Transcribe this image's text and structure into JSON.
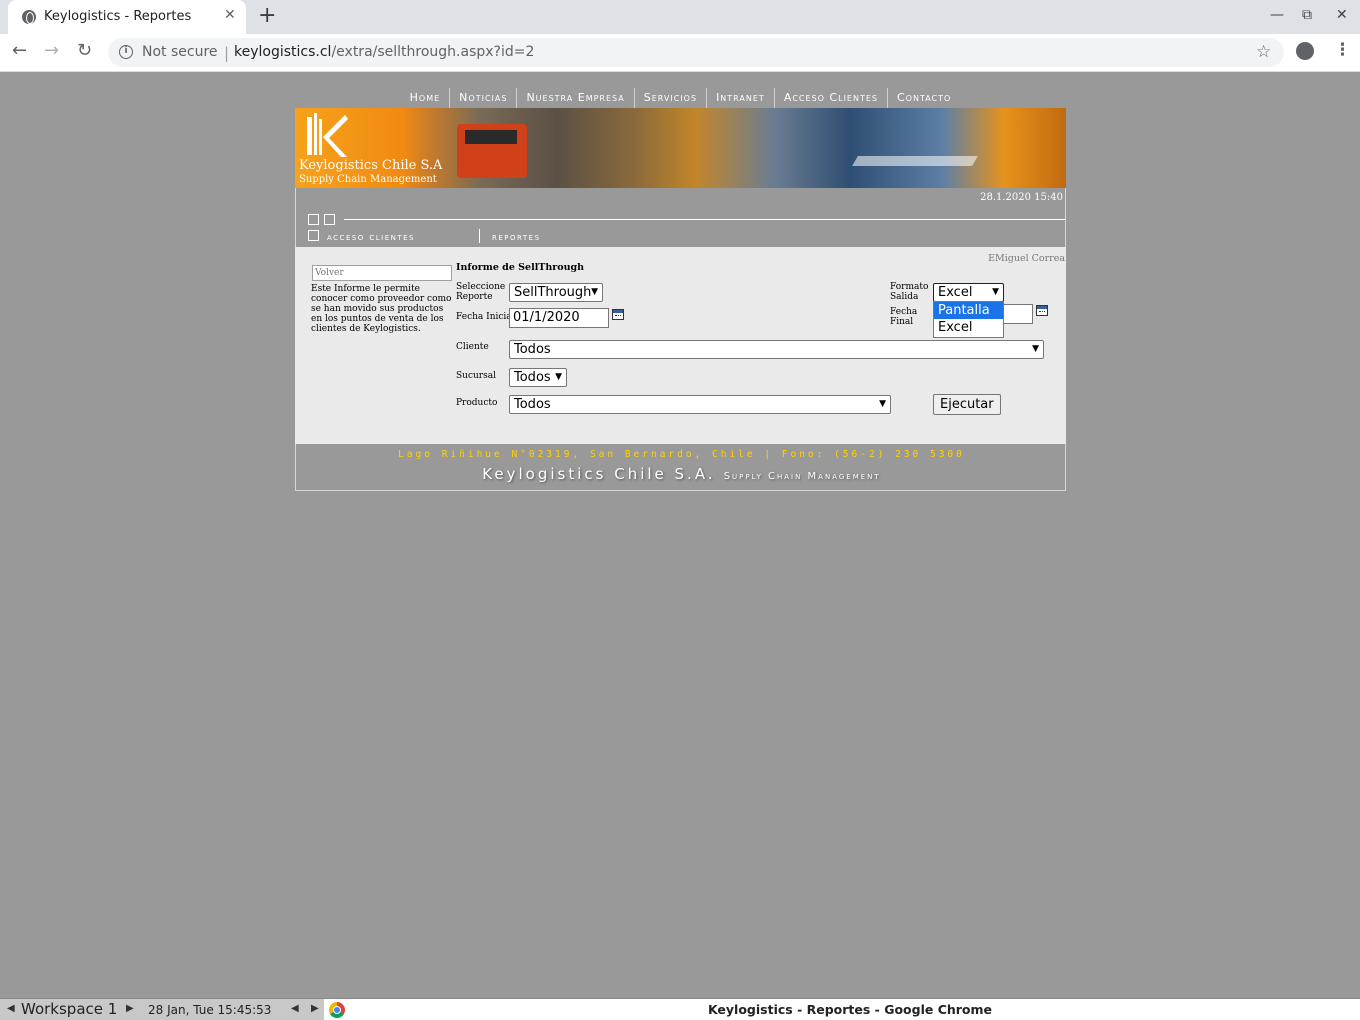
{
  "browser": {
    "tab_title": "Keylogistics - Reportes",
    "not_secure": "Not secure",
    "url_host": "keylogistics.cl",
    "url_path": "/extra/sellthrough.aspx?id=2"
  },
  "nav": {
    "items": [
      "Home",
      "Noticias",
      "Nuestra Empresa",
      "Servicios",
      "Intranet",
      "Acceso Clientes",
      "Contacto"
    ]
  },
  "banner": {
    "company": "Keylogistics Chile S.A",
    "tagline": "Supply Chain Management"
  },
  "header": {
    "datetime": "28.1.2020 15:40",
    "breadcrumb": [
      "acceso clientes",
      "reportes"
    ]
  },
  "form": {
    "user": "EMiguel Correa",
    "volver_placeholder": "Volver",
    "description": "Este Informe le permite conocer como proveedor como se han movido sus productos en los puntos de venta de los clientes de Keylogistics.",
    "title": "Informe de SellThrough",
    "seleccione_label": "Seleccione Reporte",
    "reporte_value": "SellThrough",
    "fecha_inicial_label": "Fecha Inicial",
    "fecha_inicial_value": "01/1/2020",
    "formato_label": "Formato Salida",
    "formato_value": "Excel",
    "formato_options": [
      "Pantalla",
      "Excel"
    ],
    "fecha_final_label": "Fecha Final",
    "fecha_final_value": "",
    "cliente_label": "Cliente",
    "cliente_value": "Todos",
    "sucursal_label": "Sucursal",
    "sucursal_value": "Todos",
    "producto_label": "Producto",
    "producto_value": "Todos",
    "ejecutar_label": "Ejecutar"
  },
  "footer": {
    "address": "Lago Riñihue N°02319, San Bernardo, Chile |  Fono: (56-2) 230 5300",
    "company": "Keylogistics Chile S.A.",
    "tagline": "Supply Chain Management"
  },
  "taskbar": {
    "workspace": "Workspace 1",
    "clock": "28 Jan, Tue 15:45:53",
    "window_title": "Keylogistics - Reportes - Google Chrome"
  },
  "colors": {
    "page_bg": "#999999",
    "content_bg": "#eaeaea",
    "footer_address": "#ffd200",
    "selection": "#1a73e8"
  }
}
